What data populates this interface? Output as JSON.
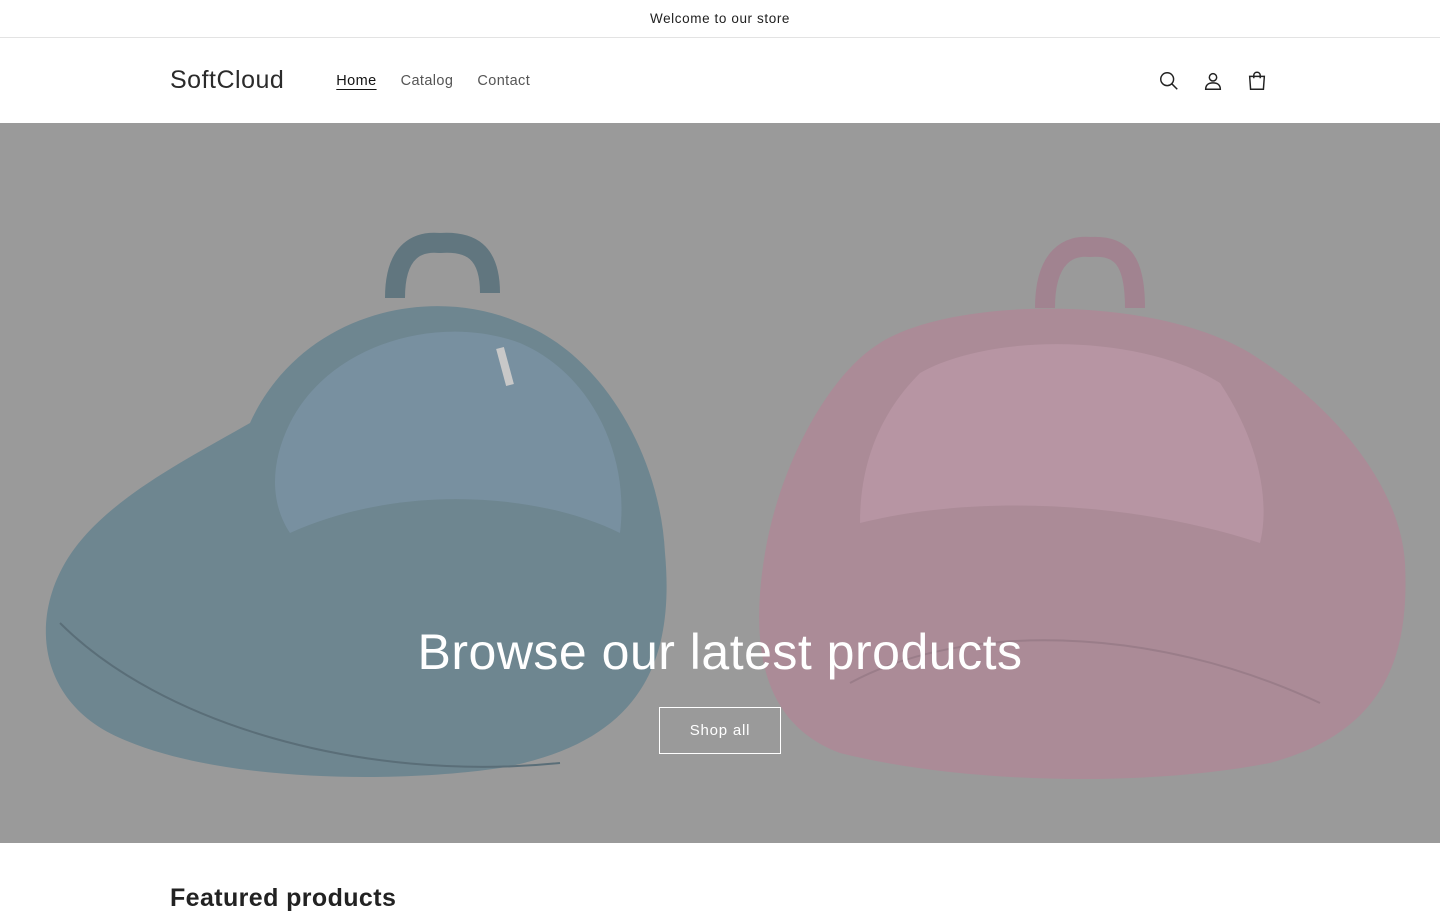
{
  "announcement": {
    "text": "Welcome to our store"
  },
  "header": {
    "logo": "SoftCloud",
    "nav": [
      {
        "label": "Home",
        "active": true
      },
      {
        "label": "Catalog",
        "active": false
      },
      {
        "label": "Contact",
        "active": false
      }
    ],
    "icons": [
      "search-icon",
      "account-icon",
      "cart-icon"
    ]
  },
  "hero": {
    "title": "Browse our latest products",
    "button_label": "Shop all",
    "overlay_color": "#9a9a9a",
    "product_colors": {
      "left": "#6e8690",
      "right": "#ab8b97"
    }
  },
  "featured": {
    "heading": "Featured products"
  }
}
